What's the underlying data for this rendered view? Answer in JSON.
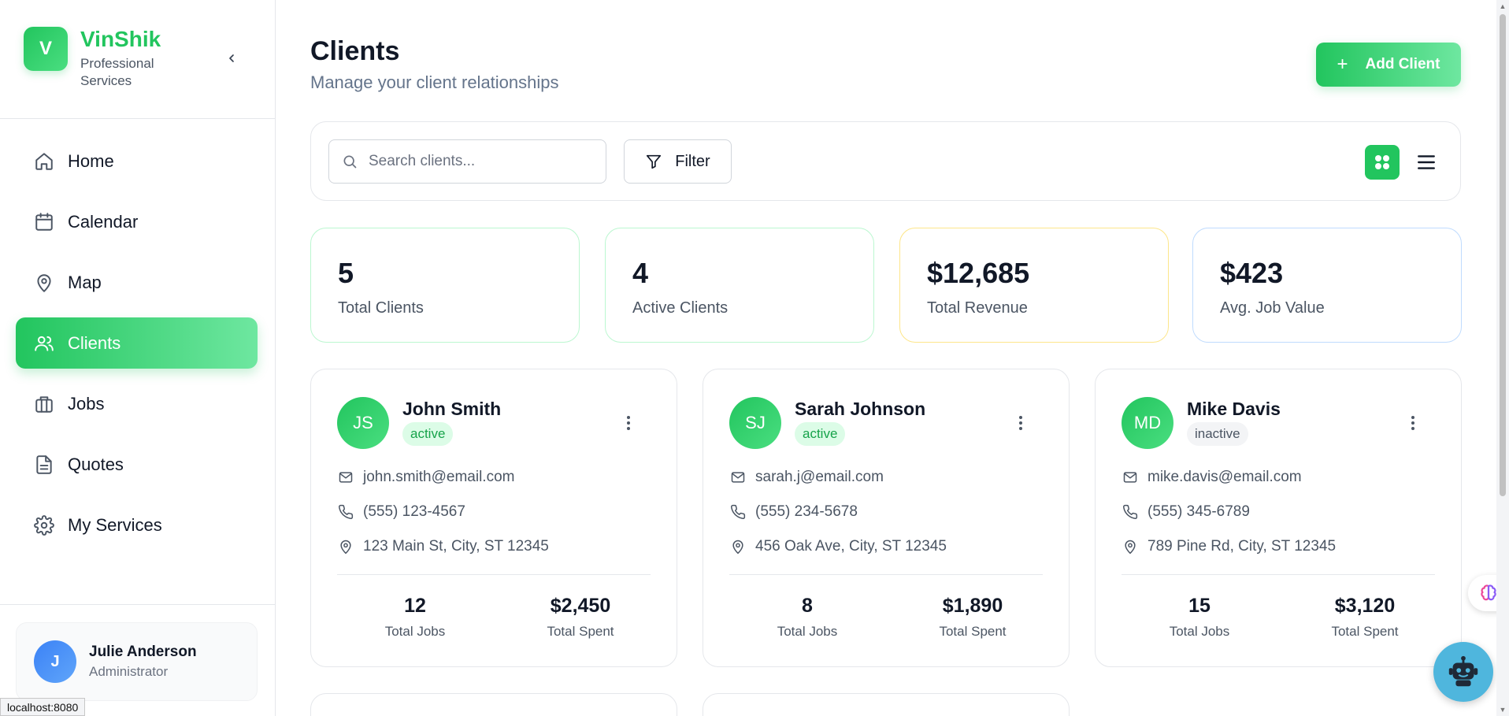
{
  "brand": {
    "logo_letter": "V",
    "name": "VinShik",
    "subtitle": "Professional Services"
  },
  "nav": {
    "items": [
      {
        "label": "Home",
        "icon": "home-icon"
      },
      {
        "label": "Calendar",
        "icon": "calendar-icon"
      },
      {
        "label": "Map",
        "icon": "map-pin-icon"
      },
      {
        "label": "Clients",
        "icon": "users-icon",
        "active": true
      },
      {
        "label": "Jobs",
        "icon": "briefcase-icon"
      },
      {
        "label": "Quotes",
        "icon": "document-icon"
      },
      {
        "label": "My Services",
        "icon": "gear-icon"
      }
    ]
  },
  "user": {
    "initial": "J",
    "name": "Julie Anderson",
    "role": "Administrator"
  },
  "header": {
    "title": "Clients",
    "subtitle": "Manage your client relationships",
    "add_label": "Add Client"
  },
  "toolbar": {
    "search_placeholder": "Search clients...",
    "filter_label": "Filter"
  },
  "stats": [
    {
      "value": "5",
      "label": "Total Clients",
      "accent": "#bbf7d0"
    },
    {
      "value": "4",
      "label": "Active Clients",
      "accent": "#bbf7d0"
    },
    {
      "value": "$12,685",
      "label": "Total Revenue",
      "accent": "#fde68a"
    },
    {
      "value": "$423",
      "label": "Avg. Job Value",
      "accent": "#bfdbfe"
    }
  ],
  "clients": [
    {
      "initials": "JS",
      "name": "John Smith",
      "status": "active",
      "email": "john.smith@email.com",
      "phone": "(555) 123-4567",
      "address": "123 Main St, City, ST 12345",
      "jobs": "12",
      "jobs_label": "Total Jobs",
      "spent": "$2,450",
      "spent_label": "Total Spent"
    },
    {
      "initials": "SJ",
      "name": "Sarah Johnson",
      "status": "active",
      "email": "sarah.j@email.com",
      "phone": "(555) 234-5678",
      "address": "456 Oak Ave, City, ST 12345",
      "jobs": "8",
      "jobs_label": "Total Jobs",
      "spent": "$1,890",
      "spent_label": "Total Spent"
    },
    {
      "initials": "MD",
      "name": "Mike Davis",
      "status": "inactive",
      "email": "mike.davis@email.com",
      "phone": "(555) 345-6789",
      "address": "789 Pine Rd, City, ST 12345",
      "jobs": "15",
      "jobs_label": "Total Jobs",
      "spent": "$3,120",
      "spent_label": "Total Spent"
    }
  ],
  "status_bar": {
    "url": "localhost:8080"
  },
  "colors": {
    "accent": "#22c55e",
    "accent_light": "#6ee7a0",
    "muted_text": "#64748b"
  }
}
